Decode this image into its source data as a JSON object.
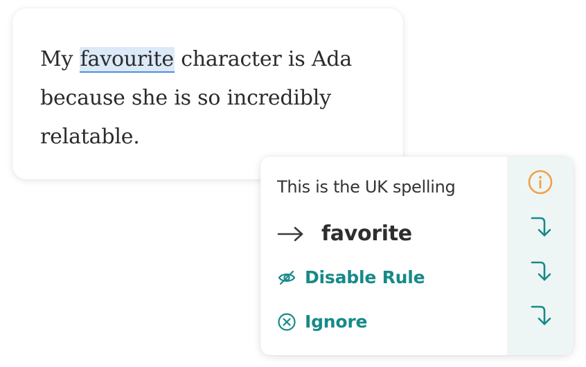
{
  "editor": {
    "text_before": "My ",
    "flagged_word": "favourite",
    "text_after": " character is Ada because she is so incredibly relatable."
  },
  "suggestion": {
    "message": "This is the UK spelling",
    "replacement": "favorite",
    "disable_rule_label": "Disable Rule",
    "ignore_label": "Ignore"
  },
  "colors": {
    "accent": "#168a88",
    "info": "#f0a04b",
    "highlight_bg": "#dbe9f8",
    "underline": "#4a90d9",
    "side_panel_bg": "#eef6f5"
  },
  "icons": {
    "arrow": "arrow-right-icon",
    "disable": "eye-slash-icon",
    "ignore": "x-circle-icon",
    "info": "info-icon",
    "apply": "corner-down-right-icon"
  }
}
